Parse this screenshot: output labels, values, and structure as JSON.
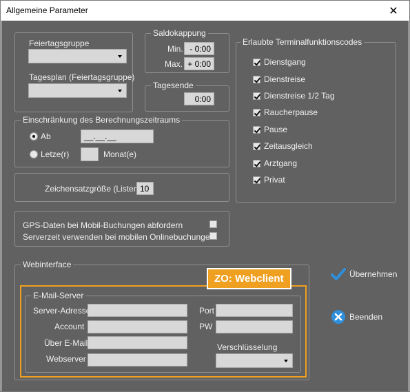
{
  "window": {
    "title": "Allgemeine Parameter",
    "close_glyph": "✕"
  },
  "feiertag": {
    "gruppe_label": "Feiertagsgruppe",
    "gruppe_value": "",
    "tagesplan_label": "Tagesplan (Feiertagsgruppe)",
    "tagesplan_value": ""
  },
  "saldo": {
    "legend": "Saldokappung",
    "min_label": "Min.",
    "min_value": "- 0:00",
    "max_label": "Max.",
    "max_value": "+ 0:00"
  },
  "tagesende": {
    "legend": "Tagesende",
    "value": "0:00"
  },
  "terminal": {
    "legend": "Erlaubte Terminalfunktionscodes",
    "items": [
      {
        "label": "Dienstgang",
        "checked": true
      },
      {
        "label": "Dienstreise",
        "checked": true
      },
      {
        "label": "Dienstreise 1/2 Tag",
        "checked": true
      },
      {
        "label": "Raucherpause",
        "checked": true
      },
      {
        "label": "Pause",
        "checked": true
      },
      {
        "label": "Zeitausgleich",
        "checked": true
      },
      {
        "label": "Arztgang",
        "checked": true
      },
      {
        "label": "Privat",
        "checked": true
      }
    ]
  },
  "zeitraum": {
    "legend": "Einschränkung des Berechnungszeitraums",
    "ab_label": "Ab",
    "ab_value": "__.__.__",
    "letzte_label": "Letze(r)",
    "letzte_value": "",
    "monat_label": "Monat(e)"
  },
  "zeichensatz": {
    "label": "Zeichensatzgröße (Listen)",
    "value": "10"
  },
  "options": {
    "gps_label": "GPS-Daten bei Mobil-Buchungen abfordern",
    "gps_checked": false,
    "serverzeit_label": "Serverzeit verwenden bei mobilen Onlinebuchungen",
    "serverzeit_checked": false
  },
  "webinterface": {
    "legend": "Webinterface",
    "badge": "ZO: Webclient",
    "email": {
      "legend": "E-Mail-Server",
      "server_label": "Server-Adresse",
      "server_value": "",
      "account_label": "Account",
      "account_value": "",
      "ueber_label": "Über E-Mail",
      "ueber_value": "",
      "webserver_label": "Webserver",
      "webserver_value": "",
      "port_label": "Port",
      "port_value": "",
      "pw_label": "PW",
      "pw_value": "",
      "verschl_label": "Verschlüsselung",
      "verschl_value": ""
    }
  },
  "actions": {
    "uebernehmen": "Übernehmen",
    "beenden": "Beenden"
  },
  "colors": {
    "background": "#616161",
    "accent": "#f0a020",
    "icon_blue": "#2f8fdc"
  }
}
